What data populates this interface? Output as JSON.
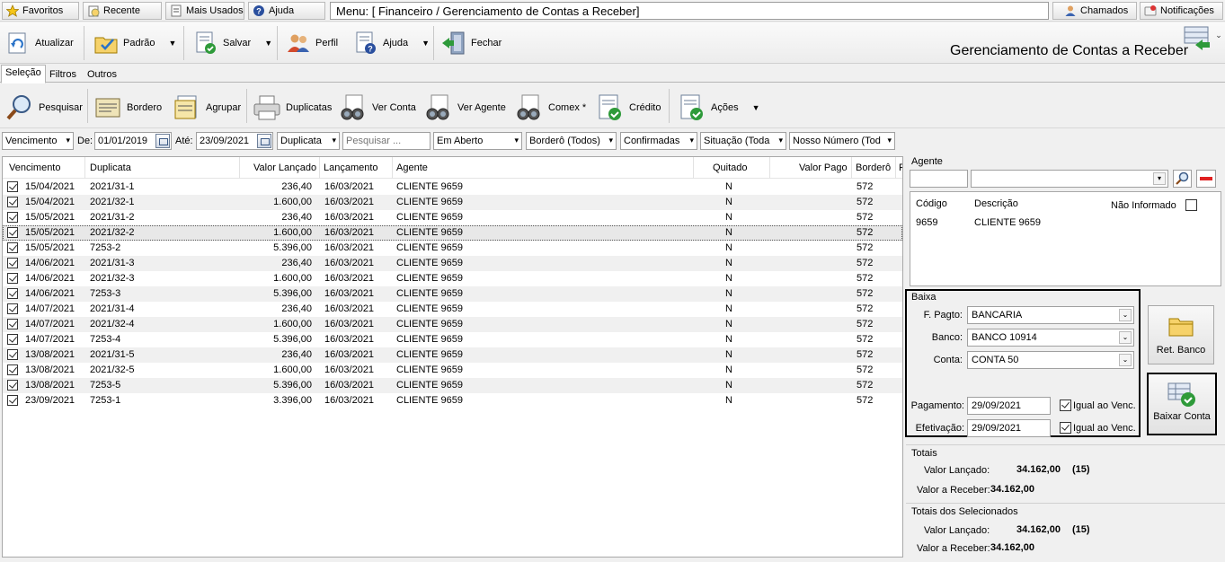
{
  "topbar": {
    "favoritos": "Favoritos",
    "recente": "Recente",
    "mais_usados": "Mais Usados",
    "ajuda": "Ajuda",
    "menu_path": "Menu: [ Financeiro / Gerenciamento de Contas a Receber]",
    "chamados": "Chamados",
    "notificacoes": "Notificações"
  },
  "toolbar": {
    "atualizar": "Atualizar",
    "padrao": "Padrão",
    "salvar": "Salvar",
    "perfil": "Perfil",
    "ajuda": "Ajuda",
    "fechar": "Fechar",
    "screen_title": "Gerenciamento de Contas a Receber"
  },
  "tabs": [
    "Seleção",
    "Filtros",
    "Outros"
  ],
  "toolbar2": {
    "pesquisar": "Pesquisar",
    "bordero": "Bordero",
    "agrupar": "Agrupar",
    "duplicatas": "Duplicatas",
    "ver_conta": "Ver Conta",
    "ver_agente": "Ver Agente",
    "comex": "Comex *",
    "credito": "Crédito",
    "acoes": "Ações"
  },
  "filters": {
    "vencimento": "Vencimento",
    "de_label": "De:",
    "de_value": "01/01/2019",
    "ate_label": "Até:",
    "ate_value": "23/09/2021",
    "tipo": "Duplicata",
    "search_placeholder": "Pesquisar ...",
    "status": "Em Aberto",
    "bordero": "Borderô (Todos)",
    "confirmadas": "Confirmadas",
    "situacao": "Situação (Toda",
    "nosso_numero": "Nosso Número (Tod"
  },
  "grid": {
    "headers": {
      "vencimento": "Vencimento",
      "duplicata": "Duplicata",
      "valor_lancado": "Valor Lançado",
      "lancamento": "Lançamento",
      "agente": "Agente",
      "quitado": "Quitado",
      "valor_pago": "Valor Pago",
      "bordero": "Borderô",
      "extra": "F"
    },
    "rows": [
      [
        "15/04/2021",
        "2021/31-1",
        "236,40",
        "16/03/2021",
        "CLIENTE 9659",
        "N",
        "",
        "572"
      ],
      [
        "15/04/2021",
        "2021/32-1",
        "1.600,00",
        "16/03/2021",
        "CLIENTE 9659",
        "N",
        "",
        "572"
      ],
      [
        "15/05/2021",
        "2021/31-2",
        "236,40",
        "16/03/2021",
        "CLIENTE 9659",
        "N",
        "",
        "572"
      ],
      [
        "15/05/2021",
        "2021/32-2",
        "1.600,00",
        "16/03/2021",
        "CLIENTE 9659",
        "N",
        "",
        "572"
      ],
      [
        "15/05/2021",
        "7253-2",
        "5.396,00",
        "16/03/2021",
        "CLIENTE 9659",
        "N",
        "",
        "572"
      ],
      [
        "14/06/2021",
        "2021/31-3",
        "236,40",
        "16/03/2021",
        "CLIENTE 9659",
        "N",
        "",
        "572"
      ],
      [
        "14/06/2021",
        "2021/32-3",
        "1.600,00",
        "16/03/2021",
        "CLIENTE 9659",
        "N",
        "",
        "572"
      ],
      [
        "14/06/2021",
        "7253-3",
        "5.396,00",
        "16/03/2021",
        "CLIENTE 9659",
        "N",
        "",
        "572"
      ],
      [
        "14/07/2021",
        "2021/31-4",
        "236,40",
        "16/03/2021",
        "CLIENTE 9659",
        "N",
        "",
        "572"
      ],
      [
        "14/07/2021",
        "2021/32-4",
        "1.600,00",
        "16/03/2021",
        "CLIENTE 9659",
        "N",
        "",
        "572"
      ],
      [
        "14/07/2021",
        "7253-4",
        "5.396,00",
        "16/03/2021",
        "CLIENTE 9659",
        "N",
        "",
        "572"
      ],
      [
        "13/08/2021",
        "2021/31-5",
        "236,40",
        "16/03/2021",
        "CLIENTE 9659",
        "N",
        "",
        "572"
      ],
      [
        "13/08/2021",
        "2021/32-5",
        "1.600,00",
        "16/03/2021",
        "CLIENTE 9659",
        "N",
        "",
        "572"
      ],
      [
        "13/08/2021",
        "7253-5",
        "5.396,00",
        "16/03/2021",
        "CLIENTE 9659",
        "N",
        "",
        "572"
      ],
      [
        "23/09/2021",
        "7253-1",
        "3.396,00",
        "16/03/2021",
        "CLIENTE 9659",
        "N",
        "",
        "572"
      ]
    ],
    "selected_row": 3
  },
  "agente": {
    "label": "Agente",
    "codigo_header": "Código",
    "descricao_header": "Descrição",
    "nao_informado": "Não Informado",
    "codigo": "9659",
    "descricao": "CLIENTE 9659"
  },
  "baixa": {
    "label": "Baixa",
    "fpagto_label": "F. Pagto:",
    "fpagto": "BANCARIA",
    "banco_label": "Banco:",
    "banco": "BANCO 10914",
    "conta_label": "Conta:",
    "conta": "CONTA 50",
    "pagamento_label": "Pagamento:",
    "pagamento": "29/09/2021",
    "efetivacao_label": "Efetivação:",
    "efetivacao": "29/09/2021",
    "igual_venc": "Igual ao Venc.",
    "ret_banco": "Ret. Banco",
    "baixar_conta": "Baixar Conta"
  },
  "totais": {
    "label": "Totais",
    "valor_lancado_label": "Valor Lançado:",
    "valor_lancado": "34.162,00",
    "count": "(15)",
    "valor_receber_label": "Valor a Receber:",
    "valor_receber": "34.162,00"
  },
  "totais_sel": {
    "label": "Totais dos Selecionados",
    "valor_lancado_label": "Valor Lançado:",
    "valor_lancado": "34.162,00",
    "count": "(15)",
    "valor_receber_label": "Valor a Receber:",
    "valor_receber": "34.162,00"
  }
}
